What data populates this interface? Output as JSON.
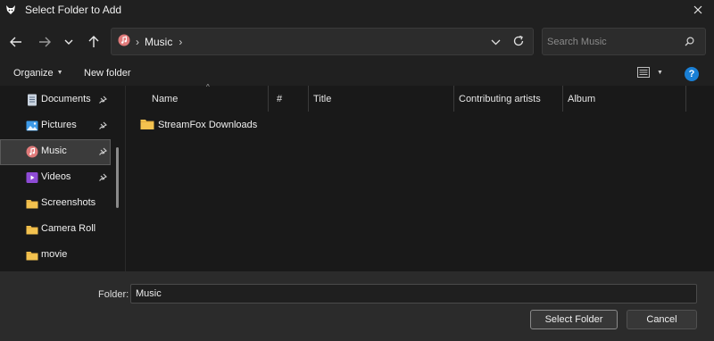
{
  "window": {
    "title": "Select Folder to Add"
  },
  "navigation": {
    "back_icon": "arrow-left-icon",
    "forward_icon": "arrow-right-icon",
    "recent_icon": "chevron-down-icon",
    "up_icon": "arrow-up-icon"
  },
  "address": {
    "crumb": "Music",
    "separator": "›"
  },
  "search": {
    "placeholder": "Search Music"
  },
  "toolbar": {
    "organize_label": "Organize",
    "new_folder_label": "New folder"
  },
  "sidebar": {
    "items": [
      {
        "label": "Documents",
        "icon": "documents-icon",
        "pinned": true
      },
      {
        "label": "Pictures",
        "icon": "pictures-icon",
        "pinned": true
      },
      {
        "label": "Music",
        "icon": "music-icon",
        "pinned": true,
        "selected": true
      },
      {
        "label": "Videos",
        "icon": "videos-icon",
        "pinned": true
      },
      {
        "label": "Screenshots",
        "icon": "folder-icon",
        "pinned": false
      },
      {
        "label": "Camera Roll",
        "icon": "folder-icon",
        "pinned": false
      },
      {
        "label": "movie",
        "icon": "folder-icon",
        "pinned": false
      }
    ]
  },
  "columns": [
    "Name",
    "#",
    "Title",
    "Contributing artists",
    "Album"
  ],
  "files": [
    {
      "name": "StreamFox Downloads",
      "type": "folder"
    }
  ],
  "bottom": {
    "folder_label": "Folder:",
    "folder_value": "Music",
    "select_label": "Select Folder",
    "cancel_label": "Cancel"
  },
  "colors": {
    "accent": "#1a7fd4",
    "folder": "#f3c24f",
    "background": "#191919"
  }
}
